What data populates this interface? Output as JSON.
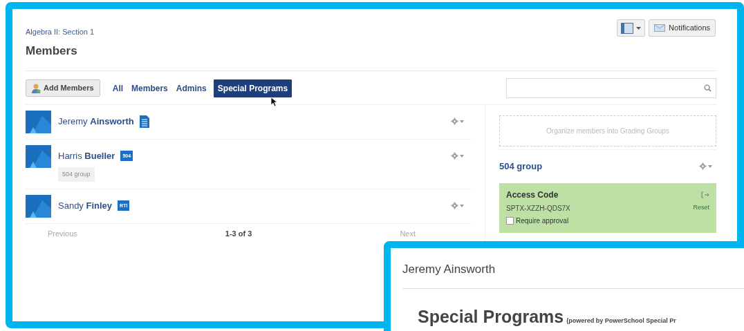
{
  "breadcrumb": "Algebra II: Section 1",
  "page_title": "Members",
  "header_buttons": {
    "notifications": "Notifications"
  },
  "toolbar": {
    "add_button": "Add Members",
    "filters": [
      {
        "label": "All",
        "selected": false
      },
      {
        "label": "Members",
        "selected": false
      },
      {
        "label": "Admins",
        "selected": false
      },
      {
        "label": "Special Programs",
        "selected": true
      }
    ]
  },
  "members": [
    {
      "first": "Jeremy",
      "last": "Ainsworth",
      "badge": {
        "kind": "document"
      }
    },
    {
      "first": "Harris",
      "last": "Bueller",
      "badge": {
        "kind": "text",
        "label": "504"
      },
      "group": "504 group"
    },
    {
      "first": "Sandy",
      "last": "Finley",
      "badge": {
        "kind": "text",
        "label": "RTI"
      }
    }
  ],
  "pagination": {
    "previous": "Previous",
    "range": "1-3 of 3",
    "next": "Next",
    "previous_disabled": true,
    "next_disabled": true
  },
  "side_panel": {
    "organize_hint": "Organize members into Grading Groups",
    "group_name": "504 group",
    "access_code": {
      "title": "Access Code",
      "code": "SPTX-XZZH-QDS7X",
      "reset": "Reset",
      "require_approval": {
        "label": "Require approval",
        "checked": false
      }
    }
  },
  "detail_popup": {
    "name": "Jeremy Ainsworth",
    "heading": "Special Programs",
    "subheading": "(powered by PowerSchool Special Pr"
  }
}
